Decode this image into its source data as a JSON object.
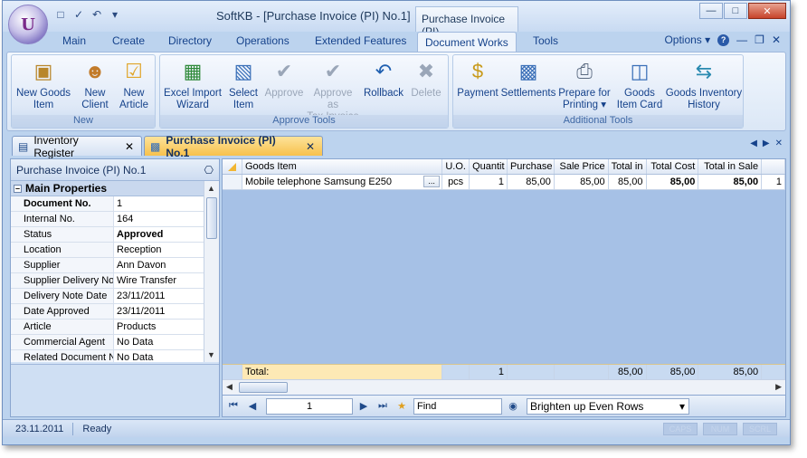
{
  "window": {
    "title": "SoftKB - [Purchase Invoice (PI) No.1]",
    "context_title": "Purchase Invoice (PI)"
  },
  "ribbon_tabs": [
    "Main",
    "Create",
    "Directory",
    "Operations",
    "Extended Features",
    "Document Works",
    "Tools"
  ],
  "options_label": "Options",
  "groups": {
    "new": {
      "label": "New",
      "buttons": [
        {
          "line1": "New Goods",
          "line2": "Item"
        },
        {
          "line1": "New",
          "line2": "Client"
        },
        {
          "line1": "New",
          "line2": "Article"
        }
      ]
    },
    "approve": {
      "label": "Approve Tools",
      "buttons": [
        {
          "line1": "Excel Import",
          "line2": "Wizard"
        },
        {
          "line1": "Select",
          "line2": "Item"
        },
        {
          "line1": "Approve",
          "line2": ""
        },
        {
          "line1": "Approve as",
          "line2": "Tax Invoice"
        },
        {
          "line1": "Rollback",
          "line2": ""
        },
        {
          "line1": "Delete",
          "line2": ""
        }
      ]
    },
    "additional": {
      "label": "Additional Tools",
      "buttons": [
        {
          "line1": "Payment",
          "line2": ""
        },
        {
          "line1": "Settlements",
          "line2": ""
        },
        {
          "line1": "Prepare for",
          "line2": "Printing"
        },
        {
          "line1": "Goods",
          "line2": "Item Card"
        },
        {
          "line1": "Goods Inventory",
          "line2": "History"
        }
      ]
    }
  },
  "doc_tabs": [
    {
      "label": "Inventory Register"
    },
    {
      "label": "Purchase Invoice (PI) No.1"
    }
  ],
  "left_pane": {
    "title": "Purchase Invoice (PI) No.1",
    "section": "Main Properties",
    "rows": [
      {
        "k": "Document No.",
        "v": "1"
      },
      {
        "k": "Internal No.",
        "v": "164"
      },
      {
        "k": "Status",
        "v": "Approved"
      },
      {
        "k": "Location",
        "v": "Reception"
      },
      {
        "k": "Supplier",
        "v": "Ann Davon"
      },
      {
        "k": "Supplier Delivery No",
        "v": "Wire Transfer"
      },
      {
        "k": "Delivery Note Date",
        "v": "23/11/2011"
      },
      {
        "k": "Date Approved",
        "v": "23/11/2011"
      },
      {
        "k": "Article",
        "v": "Products"
      },
      {
        "k": "Commercial Agent",
        "v": "No Data"
      },
      {
        "k": "Related Document N",
        "v": "No Data"
      }
    ]
  },
  "grid": {
    "columns": [
      "Goods Item",
      "U.O.",
      "Quantit",
      "Purchase",
      "Sale Price",
      "Total in",
      "Total Cost",
      "Total in Sale",
      ""
    ],
    "row": [
      "Mobile telephone Samsung E250",
      "pcs",
      "1",
      "85,00",
      "85,00",
      "85,00",
      "85,00",
      "85,00",
      "1"
    ],
    "total_label": "Total:",
    "totals": [
      "",
      "",
      "1",
      "",
      "",
      "85,00",
      "85,00",
      "85,00",
      ""
    ]
  },
  "navigator": {
    "record_value": "1",
    "find_placeholder": "Find",
    "view_option": "Brighten up Even Rows"
  },
  "status": {
    "date": "23.11.2011",
    "text": "Ready",
    "indicators": [
      "CAPS",
      "NUM",
      "SCRL"
    ]
  }
}
